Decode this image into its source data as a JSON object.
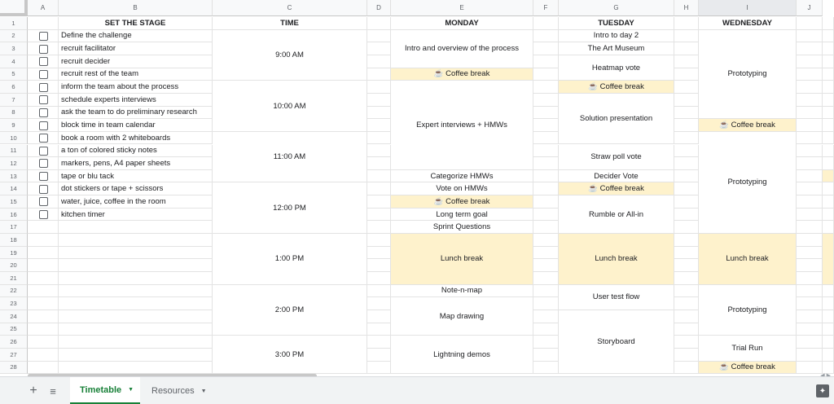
{
  "columns": [
    "A",
    "B",
    "C",
    "D",
    "E",
    "F",
    "G",
    "H",
    "I",
    "J"
  ],
  "rows": [
    "1",
    "2",
    "3",
    "4",
    "5",
    "6",
    "7",
    "8",
    "9",
    "10",
    "11",
    "12",
    "13",
    "14",
    "15",
    "16",
    "17",
    "18",
    "19",
    "20",
    "21",
    "22",
    "23",
    "24",
    "25",
    "26",
    "27",
    "28"
  ],
  "headers": {
    "set_the_stage": "SET THE STAGE",
    "time": "TIME",
    "monday": "MONDAY",
    "tuesday": "TUESDAY",
    "wednesday": "WEDNESDAY"
  },
  "checklist": [
    {
      "label": "Define the challenge",
      "checked": false
    },
    {
      "label": "recruit facilitator",
      "checked": false
    },
    {
      "label": "recruit decider",
      "checked": false
    },
    {
      "label": "recruit rest of the team",
      "checked": false
    },
    {
      "label": "inform the team about the process",
      "checked": false
    },
    {
      "label": "schedule experts interviews",
      "checked": false
    },
    {
      "label": "ask the team to do preliminary research",
      "checked": false
    },
    {
      "label": "block time in team calendar",
      "checked": false
    },
    {
      "label": "book a room with 2 whiteboards",
      "checked": false
    },
    {
      "label": "a ton of colored sticky notes",
      "checked": false
    },
    {
      "label": "markers, pens, A4 paper sheets",
      "checked": false
    },
    {
      "label": "tape or blu tack",
      "checked": false
    },
    {
      "label": "dot stickers or tape + scissors",
      "checked": false
    },
    {
      "label": "water, juice, coffee in the room",
      "checked": false
    },
    {
      "label": "kitchen timer",
      "checked": false
    }
  ],
  "times": [
    "9:00 AM",
    "10:00 AM",
    "11:00 AM",
    "12:00 PM",
    "1:00 PM",
    "2:00 PM",
    "3:00 PM"
  ],
  "monday": {
    "intro": "Intro and overview of the process",
    "coffee1": "☕ Coffee break",
    "expert": "Expert interviews + HMWs",
    "categorize": "Categorize HMWs",
    "vote": "Vote on HMWs",
    "coffee2": "☕  Coffee break",
    "longterm": "Long term goal",
    "sprintq": "Sprint Questions",
    "lunch": "Lunch break",
    "notenmap": "Note-n-map",
    "mapdrawing": "Map drawing",
    "lightning": "Lightning demos"
  },
  "tuesday": {
    "intro": "Intro to day 2",
    "museum": "The Art Museum",
    "heatmap": "Heatmap vote",
    "coffee1": "☕ Coffee break",
    "solution": "Solution presentation",
    "strawpoll": "Straw poll vote",
    "decider": "Decider Vote",
    "coffee2": "☕ Coffee break",
    "rumble": "Rumble or All-in",
    "lunch": "Lunch break",
    "usertest": "User test flow",
    "storyboard": "Storyboard"
  },
  "wednesday": {
    "proto1": "Prototyping",
    "coffee1": "☕ Coffee break",
    "proto2": "Prototyping",
    "lunch": "Lunch break",
    "proto3": "Prototyping",
    "trialrun": "Trial Run",
    "coffee2": "☕ Coffee break"
  },
  "tabs": {
    "add": "+",
    "all_sheets": "≡",
    "timetable": "Timetable",
    "resources": "Resources",
    "caret": "▼"
  },
  "colors": {
    "highlight": "#fef2cc",
    "active_tab": "#188038",
    "header_bg": "#f8f9fa"
  }
}
